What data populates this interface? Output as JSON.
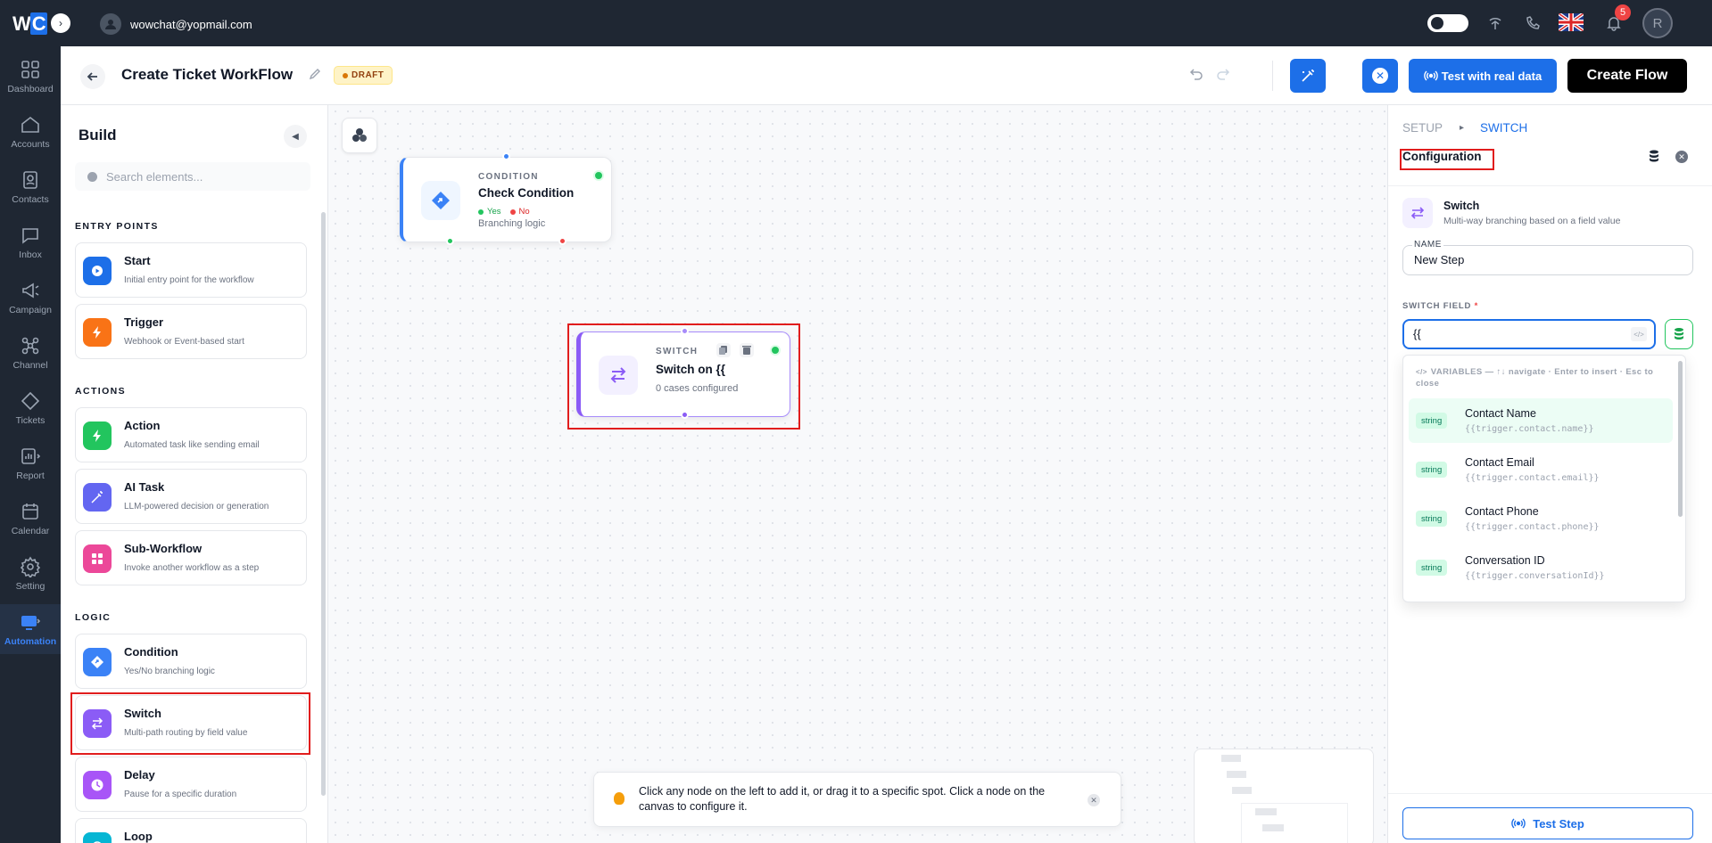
{
  "topbar": {
    "logo_text": "WC",
    "user_email": "wowchat@yopmail.com",
    "notification_count": "5",
    "profile_initial": "R"
  },
  "nav": {
    "items": [
      {
        "label": "Dashboard",
        "icon": "dashboard-icon"
      },
      {
        "label": "Accounts",
        "icon": "home-icon"
      },
      {
        "label": "Contacts",
        "icon": "contacts-icon"
      },
      {
        "label": "Inbox",
        "icon": "chat-icon"
      },
      {
        "label": "Campaign",
        "icon": "megaphone-icon"
      },
      {
        "label": "Channel",
        "icon": "channel-icon"
      },
      {
        "label": "Tickets",
        "icon": "ticket-icon"
      },
      {
        "label": "Report",
        "icon": "report-icon"
      },
      {
        "label": "Calendar",
        "icon": "calendar-icon"
      },
      {
        "label": "Setting",
        "icon": "gear-icon"
      },
      {
        "label": "Automation",
        "icon": "automation-icon"
      }
    ],
    "active": "Automation"
  },
  "header": {
    "title": "Create Ticket WorkFlow",
    "status": "DRAFT",
    "test_real_label": "Test with real data",
    "create_flow_label": "Create Flow"
  },
  "build": {
    "title": "Build",
    "search_placeholder": "Search elements...",
    "sections": {
      "entry": "ENTRY POINTS",
      "actions": "ACTIONS",
      "logic": "LOGIC"
    },
    "elements": {
      "start": {
        "name": "Start",
        "desc": "Initial entry point for the workflow"
      },
      "trigger": {
        "name": "Trigger",
        "desc": "Webhook or Event-based start"
      },
      "action": {
        "name": "Action",
        "desc": "Automated task like sending email"
      },
      "ai_task": {
        "name": "AI Task",
        "desc": "LLM-powered decision or generation"
      },
      "sub_workflow": {
        "name": "Sub-Workflow",
        "desc": "Invoke another workflow as a step"
      },
      "condition": {
        "name": "Condition",
        "desc": "Yes/No branching logic"
      },
      "switch": {
        "name": "Switch",
        "desc": "Multi-path routing by field value"
      },
      "delay": {
        "name": "Delay",
        "desc": "Pause for a specific duration"
      },
      "loop": {
        "name": "Loop",
        "desc": ""
      }
    }
  },
  "canvas": {
    "condition_node": {
      "type": "CONDITION",
      "title": "Check Condition",
      "yes": "Yes",
      "no": "No",
      "subtitle": "Branching logic"
    },
    "switch_node": {
      "type": "SWITCH",
      "title": "Switch on {{",
      "subtitle": "0 cases configured"
    },
    "tip": "Click any node on the left to add it, or drag it to a specific spot. Click a node on the canvas to configure it."
  },
  "config": {
    "crumb_setup": "SETUP",
    "crumb_switch": "SWITCH",
    "title": "Configuration",
    "node_name": "Switch",
    "node_desc": "Multi-way branching based on a field value",
    "name_label": "NAME",
    "name_value": "New Step",
    "switch_field_label": "SWITCH FIELD",
    "switch_field_required": "*",
    "switch_field_value": "{{",
    "variables_header": "VARIABLES — ↑↓ navigate · Enter to insert · Esc to close",
    "variables": [
      {
        "type": "string",
        "label": "Contact Name",
        "path": "{{trigger.contact.name}}"
      },
      {
        "type": "string",
        "label": "Contact Email",
        "path": "{{trigger.contact.email}}"
      },
      {
        "type": "string",
        "label": "Contact Phone",
        "path": "{{trigger.contact.phone}}"
      },
      {
        "type": "string",
        "label": "Conversation ID",
        "path": "{{trigger.conversationId}}"
      }
    ],
    "test_step_label": "Test Step"
  },
  "colors": {
    "primary": "#1d6fe8",
    "nav_bg": "#1f2733",
    "switch_purple": "#8b5cf6",
    "condition_blue": "#3b82f6",
    "highlight_red": "#e11d1d"
  }
}
